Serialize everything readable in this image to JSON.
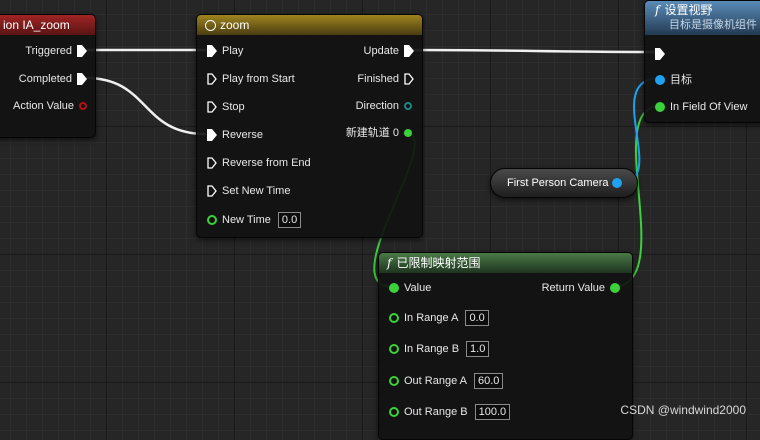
{
  "event_node": {
    "title": "ion IA_zoom",
    "pins": {
      "triggered": "Triggered",
      "completed": "Completed",
      "action_value": "Action Value"
    }
  },
  "timeline_node": {
    "title": "zoom",
    "inputs": {
      "play": "Play",
      "play_from_start": "Play from Start",
      "stop": "Stop",
      "reverse": "Reverse",
      "reverse_from_end": "Reverse from End",
      "set_new_time": "Set New Time",
      "new_time": "New Time",
      "new_time_value": "0.0"
    },
    "outputs": {
      "update": "Update",
      "finished": "Finished",
      "direction": "Direction",
      "track": "新建轨道 0"
    }
  },
  "set_fov_node": {
    "title": "设置视野",
    "subtitle": "目标是摄像机组件",
    "pins": {
      "target": "目标",
      "field_of_view": "In Field Of View"
    }
  },
  "camera_node": {
    "label": "First Person Camera"
  },
  "map_range_node": {
    "title": "已限制映射范围",
    "value": "Value",
    "return_value": "Return Value",
    "in_range_a": "In Range A",
    "in_range_a_value": "0.0",
    "in_range_b": "In Range B",
    "in_range_b_value": "1.0",
    "out_range_a": "Out Range A",
    "out_range_a_value": "60.0",
    "out_range_b": "Out Range B",
    "out_range_b_value": "100.0"
  },
  "watermark": "CSDN @windwind2000",
  "colors": {
    "exec": "#ffffff",
    "float": "#3ad13a",
    "object": "#1fa0f0"
  }
}
